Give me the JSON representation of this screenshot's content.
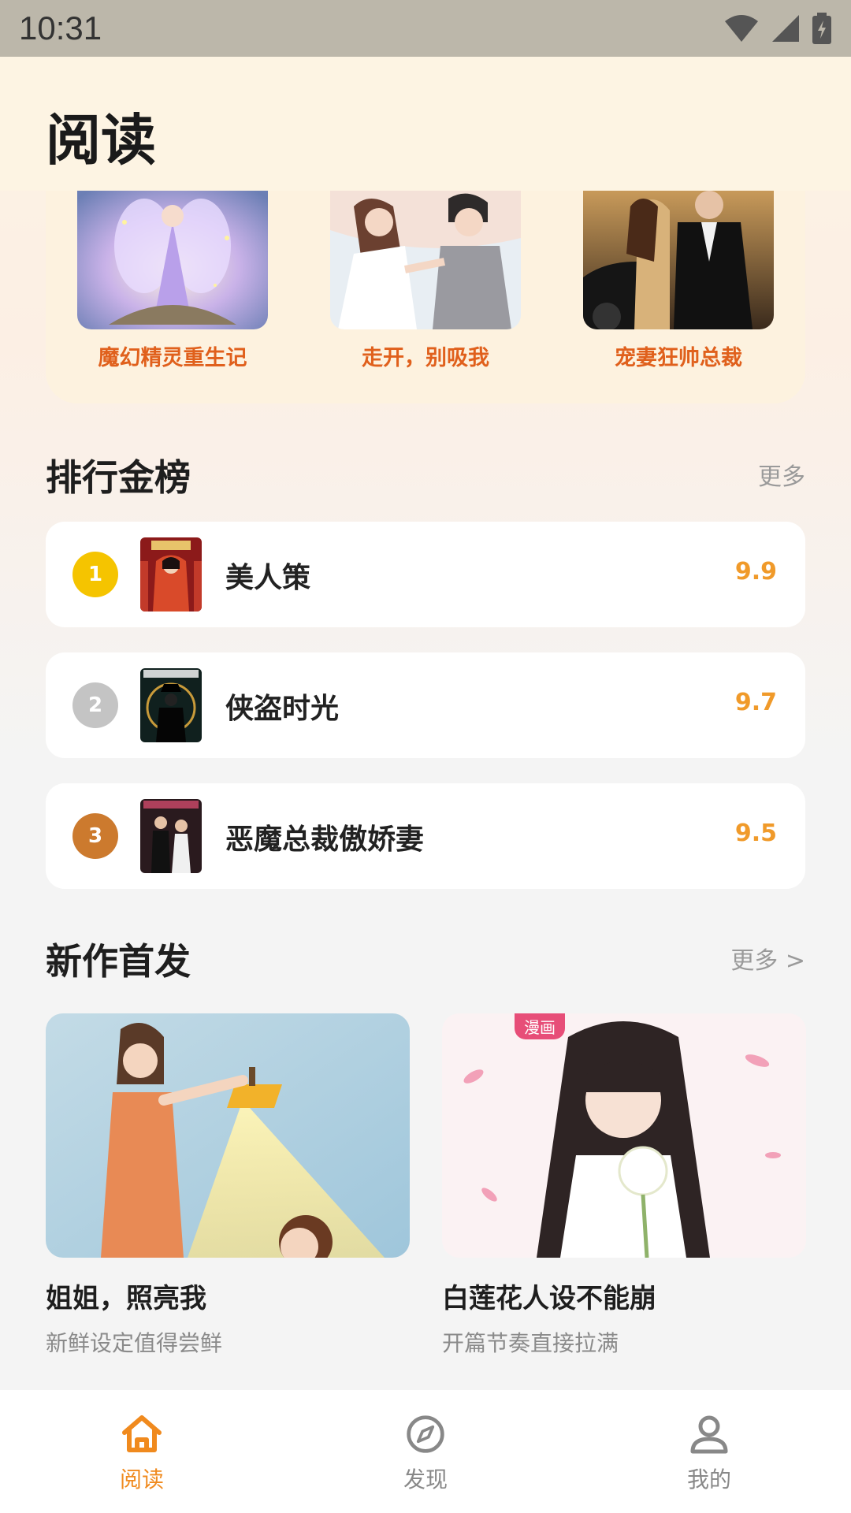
{
  "status_bar": {
    "time": "10:31"
  },
  "header": {
    "title": "阅读"
  },
  "featured": {
    "items": [
      {
        "title": "魔幻精灵重生记"
      },
      {
        "title": "走开，别吸我"
      },
      {
        "title": "宠妻狂帅总裁"
      }
    ]
  },
  "ranking": {
    "title": "排行金榜",
    "more": "更多",
    "items": [
      {
        "rank": "1",
        "name": "美人策",
        "score": "9.9",
        "badge_color": "#f5c400"
      },
      {
        "rank": "2",
        "name": "侠盗时光",
        "score": "9.7",
        "badge_color": "#c4c4c4"
      },
      {
        "rank": "3",
        "name": "恶魔总裁傲娇妻",
        "score": "9.5",
        "badge_color": "#cc7a2e"
      }
    ]
  },
  "new_releases": {
    "title": "新作首发",
    "more": "更多 >",
    "items": [
      {
        "title": "姐姐，照亮我",
        "subtitle": "新鲜设定值得尝鲜"
      },
      {
        "title": "白莲花人设不能崩",
        "subtitle": "开篇节奏直接拉满",
        "tag": "漫画"
      }
    ]
  },
  "bottom_nav": {
    "items": [
      {
        "label": "阅读",
        "icon": "home-icon",
        "active": true
      },
      {
        "label": "发现",
        "icon": "compass-icon",
        "active": false
      },
      {
        "label": "我的",
        "icon": "user-icon",
        "active": false
      }
    ]
  },
  "colors": {
    "accent": "#f08a1e",
    "featured_title": "#e0601c",
    "score": "#f09a2a",
    "nav_inactive": "#888888"
  }
}
